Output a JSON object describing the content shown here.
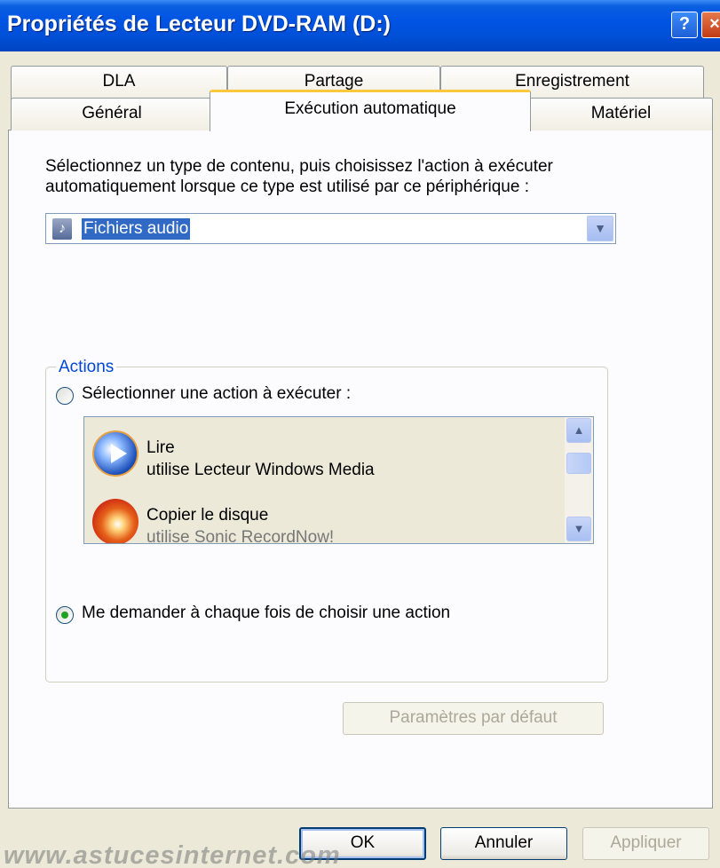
{
  "window": {
    "title": "Propriétés de Lecteur DVD-RAM (D:)",
    "help_label": "?",
    "close_label": "×"
  },
  "tabs": {
    "row1": [
      "DLA",
      "Partage",
      "Enregistrement"
    ],
    "row2": [
      "Général",
      "Exécution automatique",
      "Matériel"
    ],
    "active": "Exécution automatique"
  },
  "autoplay": {
    "instruction": "Sélectionnez un type de contenu, puis choisissez l'action à exécuter automatiquement lorsque ce type est utilisé par ce périphérique :",
    "content_type": {
      "selected": "Fichiers audio",
      "icon": "music-note-icon"
    },
    "actions": {
      "label": "Actions",
      "select_action_label": "Sélectionner une action à exécuter :",
      "ask_label": "Me demander à chaque fois de choisir une action",
      "selected_option": "ask",
      "list": [
        {
          "title": "Lire",
          "subtitle": "utilise Lecteur Windows Media",
          "icon": "windows-media-player-icon"
        },
        {
          "title": "Copier le disque",
          "subtitle": "utilise Sonic RecordNow!",
          "icon": "cd-burn-icon"
        }
      ]
    },
    "restore_defaults_label": "Paramètres par défaut"
  },
  "buttons": {
    "ok": "OK",
    "cancel": "Annuler",
    "apply": "Appliquer"
  },
  "watermark": "www.astucesinternet.com"
}
